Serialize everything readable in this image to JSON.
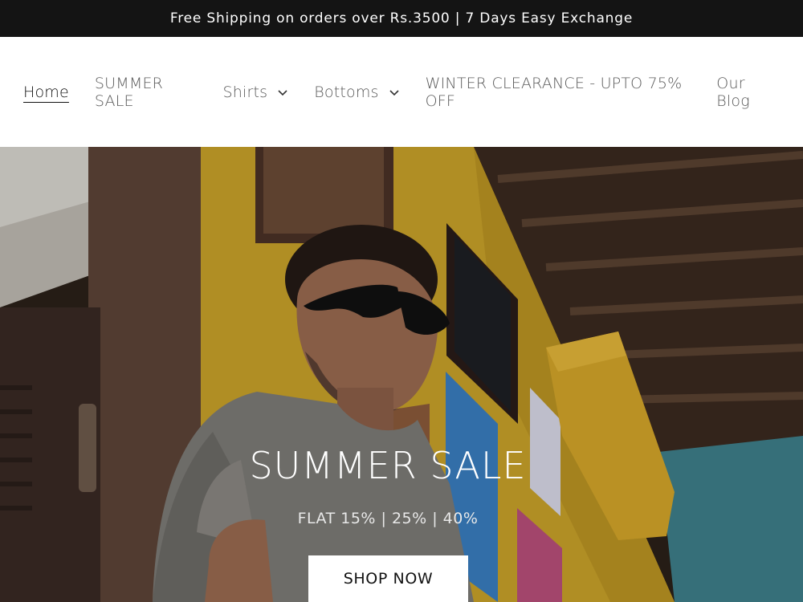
{
  "announcement": {
    "text": "Free Shipping on orders over Rs.3500 | 7 Days Easy Exchange"
  },
  "nav": {
    "items": [
      {
        "label": "Home",
        "active": true
      },
      {
        "label": "SUMMER SALE"
      },
      {
        "label": "Shirts",
        "dropdown": true
      },
      {
        "label": "Bottoms",
        "dropdown": true
      },
      {
        "label": "WINTER CLEARANCE - UPTO 75% OFF"
      },
      {
        "label": "Our Blog"
      }
    ]
  },
  "hero": {
    "title": "SUMMER SALE",
    "subtitle": "FLAT 15% | 25% | 40%",
    "button_label": "SHOP NOW"
  },
  "colors": {
    "announcement_bg": "#141414",
    "wall_yellow": "#c9a22a",
    "ceiling_brown": "#3b2a1f"
  }
}
